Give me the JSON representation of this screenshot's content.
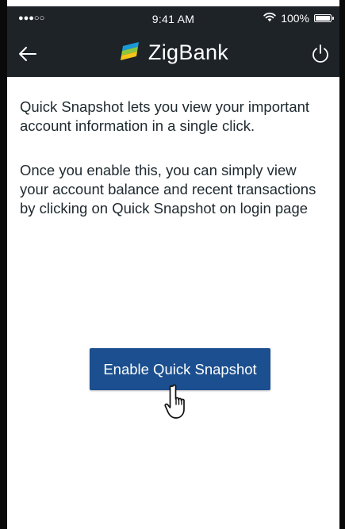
{
  "status_bar": {
    "signal": "●●●○○",
    "time": "9:41 AM",
    "battery_percent": "100%",
    "battery_level": 1.0,
    "wifi_icon": "wifi-icon"
  },
  "nav": {
    "brand_name": "ZigBank",
    "back_icon": "arrow-left-icon",
    "power_icon": "power-icon",
    "logo_icon": "zigbank-logo"
  },
  "content": {
    "intro": "Quick Snapshot lets you view your important account information in a single click.",
    "detail": "Once you enable this, you can simply view your account balance and recent transactions by clicking on Quick Snapshot on login page",
    "enable_button_label": "Enable Quick Snapshot"
  },
  "colors": {
    "header_bg": "#1e2328",
    "button_bg": "#1b4f8f",
    "text": "#1f2a30",
    "logo_blue": "#1a9bd7",
    "logo_green": "#8cc63f",
    "logo_yellow": "#f5c518"
  }
}
